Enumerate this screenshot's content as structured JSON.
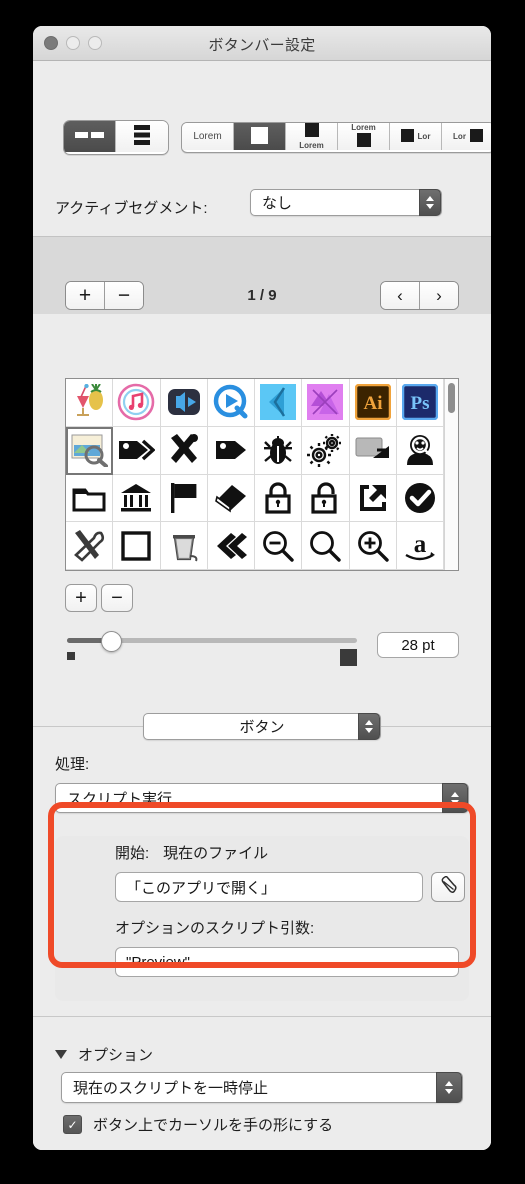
{
  "window": {
    "title": "ボタンバー設定",
    "traffic_lights": [
      "close-button",
      "minimize-button",
      "zoom-button"
    ]
  },
  "layout_segments": {
    "options": [
      {
        "name": "horizontal-layout",
        "selected": true
      },
      {
        "name": "vertical-layout",
        "selected": false
      }
    ]
  },
  "style_segments": {
    "options": [
      {
        "label": "Lorem",
        "style": "text-only",
        "selected": false
      },
      {
        "label": "",
        "style": "icon-only",
        "selected": true
      },
      {
        "label": "Lorem",
        "style": "icon-above-text",
        "selected": false
      },
      {
        "label": "Lorem",
        "style": "text-above-icon",
        "selected": false
      },
      {
        "label": "Lor",
        "style": "icon-left-text",
        "selected": false
      },
      {
        "label": "Lor",
        "style": "text-left-icon",
        "selected": false
      }
    ]
  },
  "active_segment": {
    "label": "アクティブセグメント:",
    "value": "なし"
  },
  "pager": {
    "add_label": "+",
    "remove_label": "−",
    "counter": "1 / 9",
    "prev_label": "‹",
    "next_label": "›"
  },
  "icon_grid": {
    "rows": [
      [
        {
          "name": "cocktail-pineapple-icon"
        },
        {
          "name": "itunes-icon"
        },
        {
          "name": "media-player-icon"
        },
        {
          "name": "quicktime-icon"
        },
        {
          "name": "affinity-designer-icon"
        },
        {
          "name": "affinity-photo-icon"
        },
        {
          "name": "adobe-illustrator-icon",
          "text": "Ai"
        },
        {
          "name": "adobe-photoshop-icon",
          "text": "Ps"
        }
      ],
      [
        {
          "name": "preview-image-icon",
          "selected": true
        },
        {
          "name": "tags-icon"
        },
        {
          "name": "tools-icon"
        },
        {
          "name": "tag-icon"
        },
        {
          "name": "bug-icon"
        },
        {
          "name": "gears-icon"
        },
        {
          "name": "screen-share-icon"
        },
        {
          "name": "magnifier-face-icon"
        }
      ],
      [
        {
          "name": "folder-icon"
        },
        {
          "name": "bank-icon"
        },
        {
          "name": "flag-icon"
        },
        {
          "name": "eraser-icon"
        },
        {
          "name": "lock-closed-icon"
        },
        {
          "name": "lock-open-icon"
        },
        {
          "name": "export-icon"
        },
        {
          "name": "checkmark-circle-icon"
        }
      ],
      [
        {
          "name": "screwdriver-wrench-icon"
        },
        {
          "name": "square-icon"
        },
        {
          "name": "trash-icon"
        },
        {
          "name": "chevron-double-left-icon"
        },
        {
          "name": "zoom-out-icon"
        },
        {
          "name": "search-icon"
        },
        {
          "name": "zoom-in-icon"
        },
        {
          "name": "amazon-icon"
        }
      ]
    ]
  },
  "size": {
    "add_label": "+",
    "remove_label": "−",
    "value": "28 pt",
    "slider_percent": 15
  },
  "kind_popup": {
    "value": "ボタン"
  },
  "action": {
    "label": "処理:",
    "value": "スクリプト実行"
  },
  "script": {
    "start_label": "開始:",
    "start_value": "現在のファイル",
    "path_value": "「このアプリで開く」",
    "edit_button": "script-edit-icon",
    "args_label": "オプションのスクリプト引数:",
    "args_value": "\"Preview\""
  },
  "options": {
    "disclosure_label": "オプション",
    "popup_value": "現在のスクリプトを一時停止",
    "checkbox_label": "ボタン上でカーソルを手の形にする",
    "checkbox_checked": true,
    "check_glyph": "✓"
  },
  "annotation": {
    "color": "#ef4a28"
  }
}
